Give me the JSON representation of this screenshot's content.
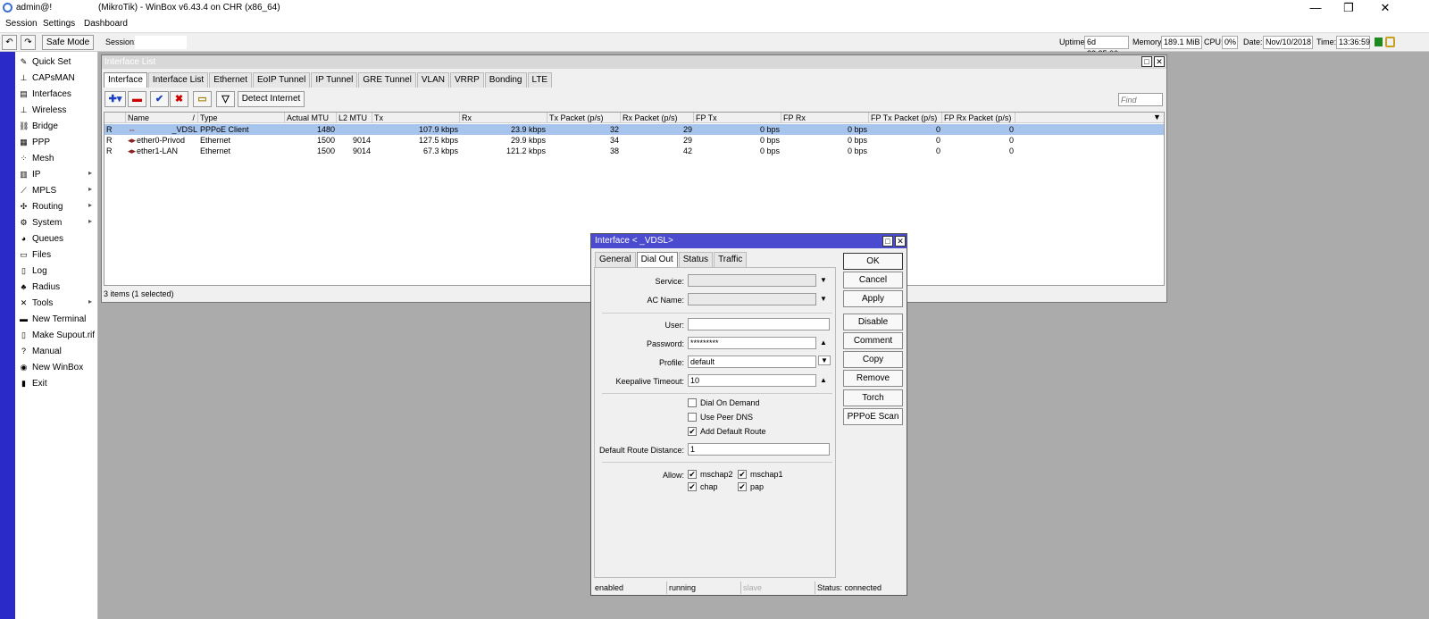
{
  "titlebar": {
    "user": "admin@!",
    "title": "(MikroTik) - WinBox v6.43.4 on CHR (x86_64)",
    "min": "—",
    "restore": "❐",
    "close": "✕"
  },
  "menu": [
    "Session",
    "Settings",
    "Dashboard"
  ],
  "toolbar": {
    "undo": "↶",
    "redo": "↷",
    "safe_mode": "Safe Mode",
    "session_label": "Session:",
    "uptime_label": "Uptime:",
    "uptime": "6d 22:35:06",
    "memory_label": "Memory:",
    "memory": "189.1 MiB",
    "cpu_label": "CPU:",
    "cpu": "0%",
    "date_label": "Date:",
    "date": "Nov/10/2018",
    "time_label": "Time:",
    "time": "13:36:59"
  },
  "sidebar": {
    "items": [
      {
        "label": "Quick Set",
        "icon": "quickset-icon",
        "glyph": "✎"
      },
      {
        "label": "CAPsMAN",
        "icon": "capsman-icon",
        "glyph": "⊥"
      },
      {
        "label": "Interfaces",
        "icon": "interfaces-icon",
        "glyph": "▤"
      },
      {
        "label": "Wireless",
        "icon": "wireless-icon",
        "glyph": "⊥"
      },
      {
        "label": "Bridge",
        "icon": "bridge-icon",
        "glyph": "⛓"
      },
      {
        "label": "PPP",
        "icon": "ppp-icon",
        "glyph": "▦"
      },
      {
        "label": "Mesh",
        "icon": "mesh-icon",
        "glyph": "⁘"
      },
      {
        "label": "IP",
        "icon": "ip-icon",
        "glyph": "▥",
        "arrow": "▸"
      },
      {
        "label": "MPLS",
        "icon": "mpls-icon",
        "glyph": "⟋",
        "arrow": "▸"
      },
      {
        "label": "Routing",
        "icon": "routing-icon",
        "glyph": "✣",
        "arrow": "▸"
      },
      {
        "label": "System",
        "icon": "system-icon",
        "glyph": "⚙",
        "arrow": "▸"
      },
      {
        "label": "Queues",
        "icon": "queues-icon",
        "glyph": "◕"
      },
      {
        "label": "Files",
        "icon": "files-icon",
        "glyph": "▭"
      },
      {
        "label": "Log",
        "icon": "log-icon",
        "glyph": "▯"
      },
      {
        "label": "Radius",
        "icon": "radius-icon",
        "glyph": "♣"
      },
      {
        "label": "Tools",
        "icon": "tools-icon",
        "glyph": "✕",
        "arrow": "▸"
      },
      {
        "label": "New Terminal",
        "icon": "terminal-icon",
        "glyph": "▬"
      },
      {
        "label": "Make Supout.rif",
        "icon": "supout-icon",
        "glyph": "▯"
      },
      {
        "label": "Manual",
        "icon": "manual-icon",
        "glyph": "?"
      },
      {
        "label": "New WinBox",
        "icon": "winbox-icon",
        "glyph": "◉"
      },
      {
        "label": "Exit",
        "icon": "exit-icon",
        "glyph": "▮"
      }
    ]
  },
  "iflist": {
    "title": "Interface List",
    "tabs": [
      "Interface",
      "Interface List",
      "Ethernet",
      "EoIP Tunnel",
      "IP Tunnel",
      "GRE Tunnel",
      "VLAN",
      "VRRP",
      "Bonding",
      "LTE"
    ],
    "detect_internet": "Detect Internet",
    "find_placeholder": "Find",
    "columns": [
      "Name",
      "Type",
      "Actual MTU",
      "L2 MTU",
      "Tx",
      "Rx",
      "Tx Packet (p/s)",
      "Rx Packet (p/s)",
      "FP Tx",
      "FP Rx",
      "FP Tx Packet (p/s)",
      "FP Rx Packet (p/s)"
    ],
    "sort_glyph": "/",
    "rows": [
      {
        "flag": "R",
        "icon": "⇔",
        "name": "_VDSL",
        "type": "PPPoE Client",
        "mtu": "1480",
        "l2mtu": "",
        "tx": "107.9 kbps",
        "rx": "23.9 kbps",
        "txp": "32",
        "rxp": "29",
        "fptx": "0 bps",
        "fprx": "0 bps",
        "fptxp": "0",
        "fprxp": "0"
      },
      {
        "flag": "R",
        "icon": "◂▸",
        "name": "ether0-Privod",
        "type": "Ethernet",
        "mtu": "1500",
        "l2mtu": "9014",
        "tx": "127.5 kbps",
        "rx": "29.9 kbps",
        "txp": "34",
        "rxp": "29",
        "fptx": "0 bps",
        "fprx": "0 bps",
        "fptxp": "0",
        "fprxp": "0"
      },
      {
        "flag": "R",
        "icon": "◂▸",
        "name": "ether1-LAN",
        "type": "Ethernet",
        "mtu": "1500",
        "l2mtu": "9014",
        "tx": "67.3 kbps",
        "rx": "121.2 kbps",
        "txp": "38",
        "rxp": "42",
        "fptx": "0 bps",
        "fprx": "0 bps",
        "fptxp": "0",
        "fprxp": "0"
      }
    ],
    "status": "3 items (1 selected)"
  },
  "dialog": {
    "title": "Interface <          _VDSL>",
    "tabs": [
      "General",
      "Dial Out",
      "Status",
      "Traffic"
    ],
    "service_label": "Service:",
    "service": "",
    "ac_name_label": "AC Name:",
    "ac_name": "",
    "user_label": "User:",
    "user": "",
    "password_label": "Password:",
    "password": "*********",
    "profile_label": "Profile:",
    "profile": "default",
    "keepalive_label": "Keepalive Timeout:",
    "keepalive": "10",
    "dial_on_demand": "Dial On Demand",
    "use_peer_dns": "Use Peer DNS",
    "add_default_route": "Add Default Route",
    "default_route_distance_label": "Default Route Distance:",
    "default_route_distance": "1",
    "allow_label": "Allow:",
    "allow": {
      "mschap2": "mschap2",
      "mschap1": "mschap1",
      "chap": "chap",
      "pap": "pap"
    },
    "buttons": [
      "OK",
      "Cancel",
      "Apply",
      "Disable",
      "Comment",
      "Copy",
      "Remove",
      "Torch",
      "PPPoE Scan"
    ],
    "status_bar": {
      "enabled": "enabled",
      "running": "running",
      "slave": "slave",
      "status": "Status: connected"
    },
    "check": "✔"
  }
}
